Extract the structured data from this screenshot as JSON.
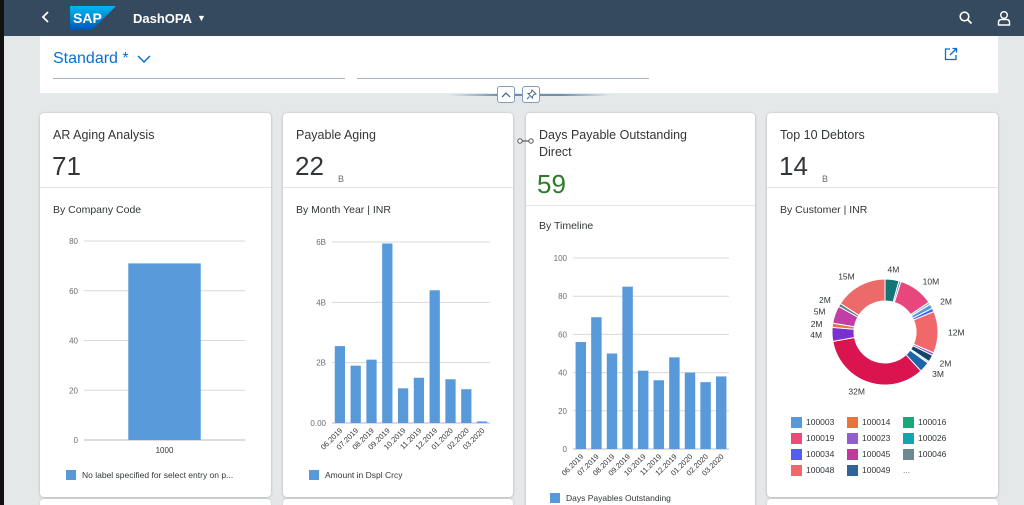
{
  "shell": {
    "back_icon": "chevron-left-icon",
    "logo_text": "SAP",
    "app_title": "DashOPA",
    "search_icon": "search-icon",
    "user_icon": "user-icon"
  },
  "header": {
    "variant_label": "Standard *",
    "share_icon": "share-icon",
    "collapse_icon": "chevron-up-icon",
    "pin_icon": "pin-icon"
  },
  "colors": {
    "shell_bg": "#354a5f",
    "accent": "#0a6ed1",
    "bar": "#5899da",
    "kpi_positive": "#2b7d2b"
  },
  "cards": [
    {
      "title": "AR Aging Analysis",
      "kpi": "71",
      "unit": "",
      "subtitle": "By Company Code",
      "legend": "No label specified for select entry on p..."
    },
    {
      "title": "Payable Aging",
      "kpi": "22",
      "unit": "B",
      "subtitle": "By Month Year | INR",
      "legend": "Amount in Dspl Crcy"
    },
    {
      "title": "Days Payable Outstanding Direct",
      "title_line1": "Days Payable Outstanding",
      "title_line2": "Direct",
      "kpi": "59",
      "unit": "",
      "subtitle": "By Timeline",
      "legend": "Days Payables Outstanding"
    },
    {
      "title": "Top 10 Debtors",
      "kpi": "14",
      "unit": "B",
      "subtitle": "By Customer | INR",
      "legend_more": "..."
    }
  ],
  "chart_data": [
    {
      "type": "bar",
      "title": "AR Aging Analysis",
      "categories": [
        "1000"
      ],
      "values": [
        71
      ],
      "ylim": [
        0,
        80
      ],
      "yticks": [
        "0",
        "20",
        "40",
        "60",
        "80"
      ],
      "ytick_values": [
        0,
        20,
        40,
        60,
        80
      ],
      "legend": [
        "No label specified for select entry on p..."
      ],
      "grid": true
    },
    {
      "type": "bar",
      "title": "Payable Aging",
      "categories": [
        "06.2019",
        "07.2019",
        "08.2019",
        "09.2019",
        "10.2019",
        "11.2019",
        "12.2019",
        "01.2020",
        "02.2020",
        "03.2020"
      ],
      "values": [
        2.55,
        1.9,
        2.1,
        5.95,
        1.15,
        1.5,
        4.4,
        1.45,
        1.12,
        0.05
      ],
      "units": "B",
      "ylim": [
        0,
        6
      ],
      "yticks": [
        "0.00",
        "2B",
        "4B",
        "6B"
      ],
      "ytick_values": [
        0,
        2,
        4,
        6
      ],
      "legend": [
        "Amount in Dspl Crcy"
      ],
      "grid": true
    },
    {
      "type": "bar",
      "title": "Days Payable Outstanding Direct",
      "categories": [
        "06.2019",
        "07.2019",
        "08.2019",
        "09.2019",
        "10.2019",
        "11.2019",
        "12.2019",
        "01.2020",
        "02.2020",
        "03.2020"
      ],
      "values": [
        56,
        69,
        50,
        85,
        41,
        36,
        48,
        40,
        35,
        38
      ],
      "ylim": [
        0,
        100
      ],
      "yticks": [
        "0",
        "20",
        "40",
        "60",
        "80",
        "100"
      ],
      "ytick_values": [
        0,
        20,
        40,
        60,
        80,
        100
      ],
      "legend": [
        "Days Payables Outstanding"
      ],
      "grid": true
    },
    {
      "type": "pie",
      "subtype": "donut",
      "title": "Top 10 Debtors",
      "slices": [
        {
          "name": "100016",
          "value": 4,
          "color": "#147575",
          "label": "4M"
        },
        {
          "name": "100003",
          "value": 0.6,
          "color": "#5899da",
          "label": ""
        },
        {
          "name": "100019",
          "value": 10,
          "color": "#e8467c",
          "label": "10M"
        },
        {
          "name": "100046",
          "value": 0.7,
          "color": "#9bb8c4",
          "label": ""
        },
        {
          "name": "100003b",
          "value": 1.3,
          "color": "#5899da",
          "label": "2M"
        },
        {
          "name": "100034",
          "value": 1,
          "color": "#4c5ef2",
          "label": ""
        },
        {
          "name": "100048",
          "value": 12,
          "color": "#f0686a",
          "label": "12M"
        },
        {
          "name": "100023",
          "value": 0.8,
          "color": "#945ecf",
          "label": ""
        },
        {
          "name": "100049",
          "value": 2,
          "color": "#13456d",
          "label": "2M"
        },
        {
          "name": "100026",
          "value": 0.5,
          "color": "#9bd9e0",
          "label": ""
        },
        {
          "name": "100049b",
          "value": 3,
          "color": "#1d64a8",
          "label": "3M"
        },
        {
          "name": "100019b",
          "value": 32,
          "color": "#d9144f",
          "label": "32M"
        },
        {
          "name": "100023b",
          "value": 4,
          "color": "#7c2fd0",
          "label": "4M"
        },
        {
          "name": "100014",
          "value": 1.2,
          "color": "#e8743b",
          "label": "2M"
        },
        {
          "name": "100045",
          "value": 5,
          "color": "#c13ea6",
          "label": "5M"
        },
        {
          "name": "100046b",
          "value": 1,
          "color": "#637c85",
          "label": "2M"
        },
        {
          "name": "100048b",
          "value": 15,
          "color": "#ec6a6a",
          "label": "15M"
        }
      ],
      "legend": [
        {
          "name": "100003",
          "color": "#5899da"
        },
        {
          "name": "100014",
          "color": "#e8743b"
        },
        {
          "name": "100016",
          "color": "#19a979"
        },
        {
          "name": "100019",
          "color": "#ed4a7b"
        },
        {
          "name": "100023",
          "color": "#945ecf"
        },
        {
          "name": "100026",
          "color": "#13a4b4"
        },
        {
          "name": "100034",
          "color": "#525df4"
        },
        {
          "name": "100045",
          "color": "#bf399e"
        },
        {
          "name": "100046",
          "color": "#6c8893"
        },
        {
          "name": "100048",
          "color": "#ee6868"
        },
        {
          "name": "100049",
          "color": "#2f6497"
        }
      ]
    }
  ]
}
